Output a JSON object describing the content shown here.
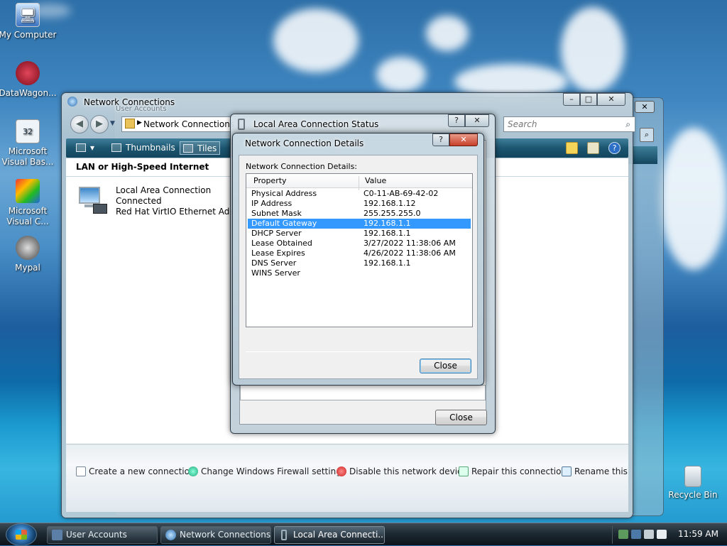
{
  "desktop": {
    "icons": [
      {
        "label": "My Computer",
        "name": "my-computer-icon"
      },
      {
        "label": "DataWagon...",
        "name": "datawagon-icon"
      },
      {
        "label": "Microsoft Visual Bas...",
        "name": "visual-basic-icon"
      },
      {
        "label": "Microsoft Visual C...",
        "name": "visual-c-icon"
      },
      {
        "label": "Mypal",
        "name": "mypal-icon"
      },
      {
        "label": "Recycle Bin",
        "name": "recycle-bin-icon"
      }
    ]
  },
  "back_window": {
    "title": "User Accounts"
  },
  "network_window": {
    "title": "Network Connections",
    "breadcrumb": "Network Connections",
    "search_placeholder": "Search",
    "toolbar": {
      "thumbnails": "Thumbnails",
      "tiles": "Tiles"
    },
    "group_header": "LAN or High-Speed Internet",
    "connection": {
      "name": "Local Area Connection",
      "status": "Connected",
      "adapter": "Red Hat VirtIO Ethernet Adapter"
    },
    "tasks": [
      "Create a new connection",
      "Change Windows Firewall settings",
      "Disable this network device",
      "Repair this connection",
      "Rename this"
    ]
  },
  "status_dialog": {
    "title": "Local Area Connection Status",
    "close_label": "Close"
  },
  "details_dialog": {
    "title": "Network Connection Details",
    "label": "Network Connection Details:",
    "columns": {
      "property": "Property",
      "value": "Value"
    },
    "rows": [
      {
        "property": "Physical Address",
        "value": "C0-11-AB-69-42-02"
      },
      {
        "property": "IP Address",
        "value": "192.168.1.12"
      },
      {
        "property": "Subnet Mask",
        "value": "255.255.255.0"
      },
      {
        "property": "Default Gateway",
        "value": "192.168.1.1",
        "selected": true
      },
      {
        "property": "DHCP Server",
        "value": "192.168.1.1"
      },
      {
        "property": "Lease Obtained",
        "value": "3/27/2022 11:38:06 AM"
      },
      {
        "property": "Lease Expires",
        "value": "4/26/2022 11:38:06 AM"
      },
      {
        "property": "DNS Server",
        "value": "192.168.1.1"
      },
      {
        "property": "WINS Server",
        "value": ""
      }
    ],
    "close_label": "Close"
  },
  "taskbar": {
    "buttons": [
      "User Accounts",
      "Network Connections",
      "Local Area Connecti..."
    ],
    "clock": "11:59 AM"
  }
}
